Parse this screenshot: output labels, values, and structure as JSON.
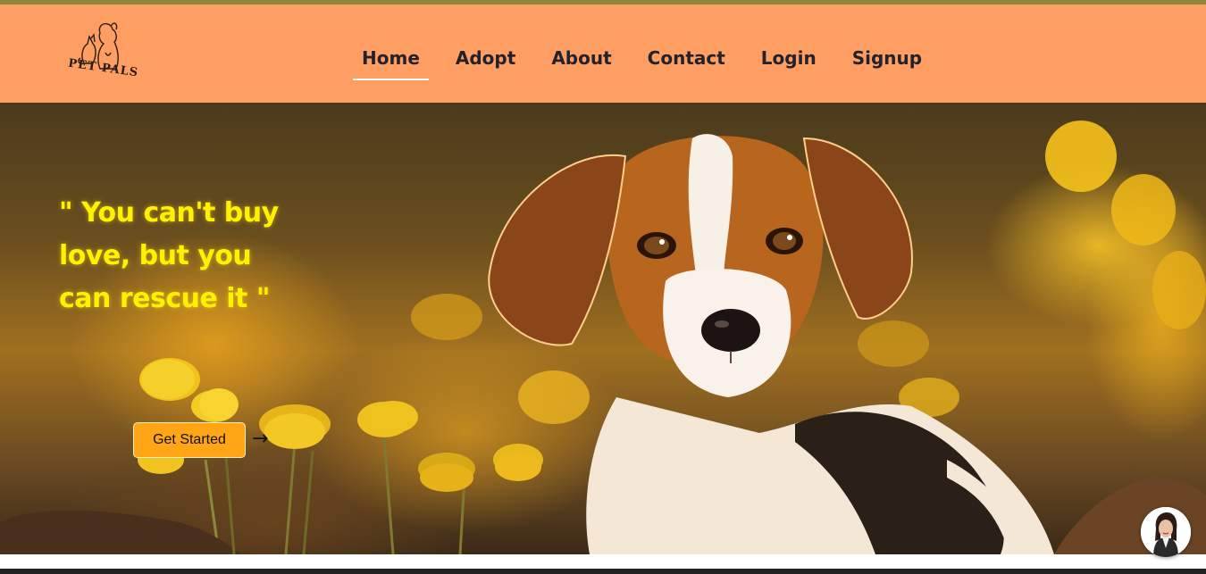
{
  "brand": {
    "logo_text": "PET PALS"
  },
  "nav": {
    "items": [
      {
        "label": "Home",
        "active": true
      },
      {
        "label": "Adopt",
        "active": false
      },
      {
        "label": "About",
        "active": false
      },
      {
        "label": "Contact",
        "active": false
      },
      {
        "label": "Login",
        "active": false
      },
      {
        "label": "Signup",
        "active": false
      }
    ]
  },
  "hero": {
    "quote_line1": "\" You can't buy",
    "quote_line2": "love, but you",
    "quote_line3": "can rescue it \"",
    "cta_label": "Get Started",
    "cta_icon": "arrow-right-icon",
    "image": "beagle-puppy-in-yellow-flowers"
  },
  "chat": {
    "icon": "support-agent-avatar"
  },
  "colors": {
    "navbar": "#ff9e63",
    "quote": "#fff200",
    "cta": "#ffa516",
    "top_strip": "#8a8a3a"
  }
}
